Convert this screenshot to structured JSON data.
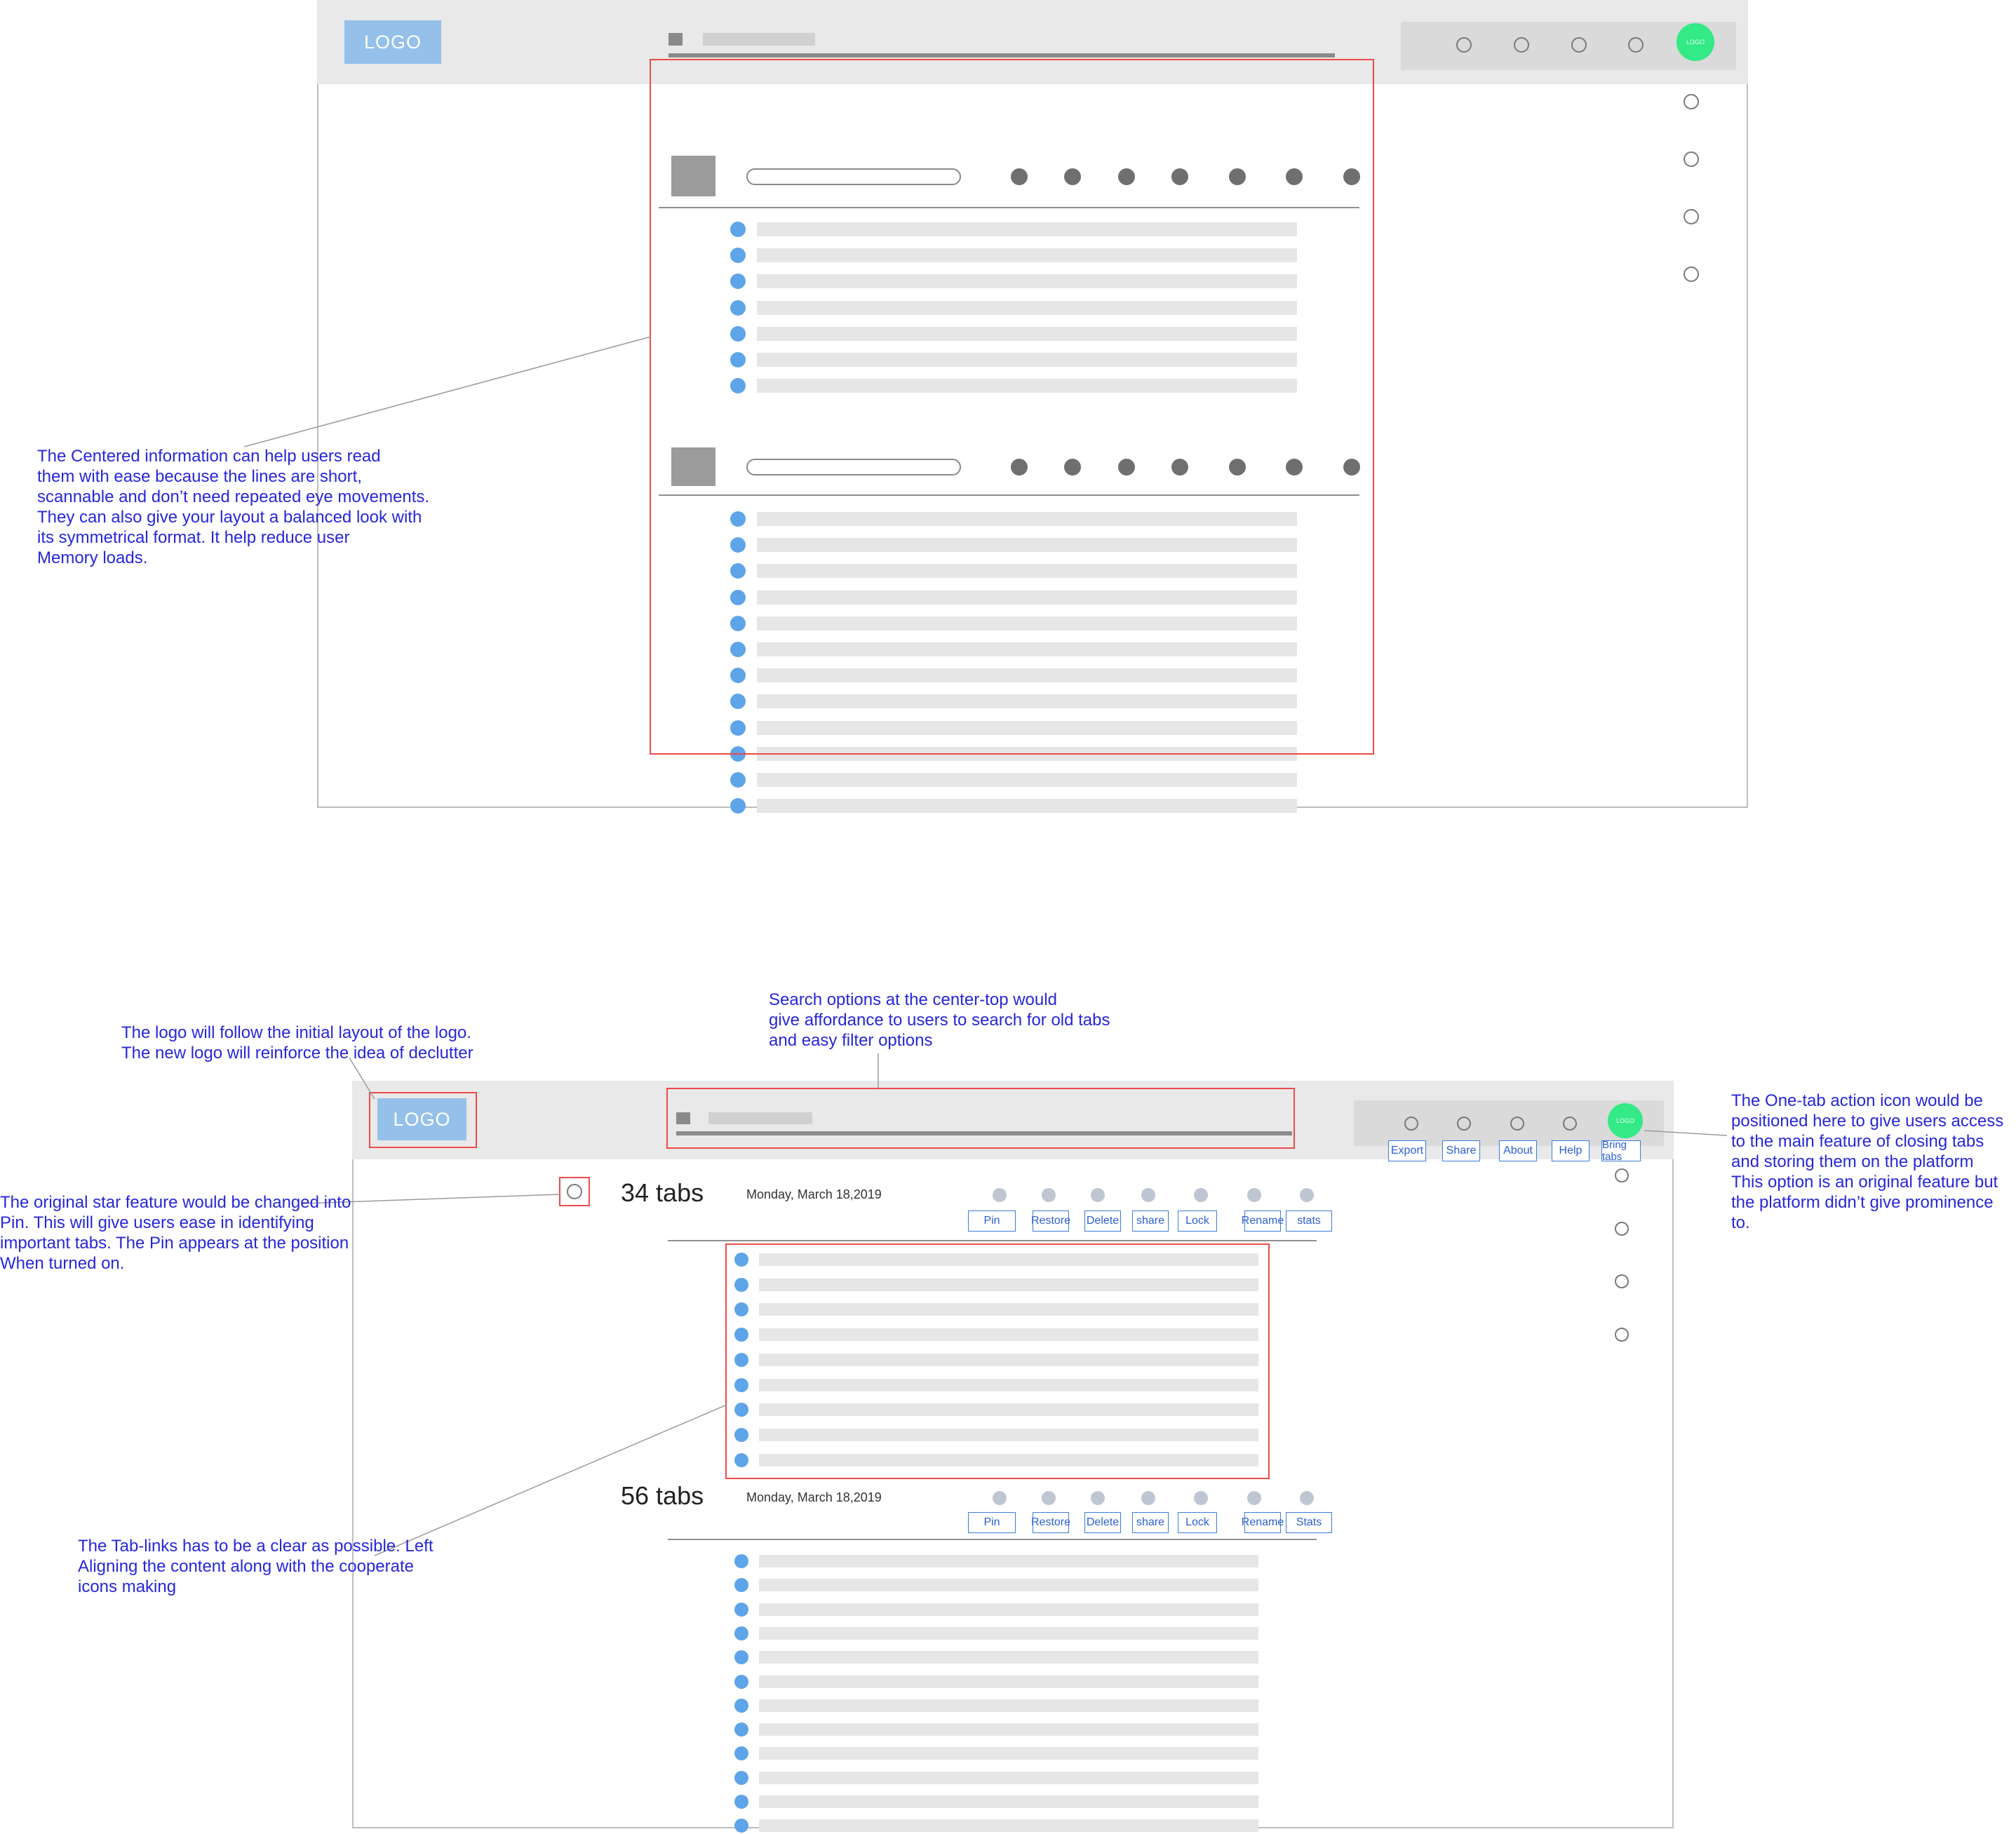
{
  "wireframe_top": {
    "logo_label": "LOGO",
    "avatar_label": "LOGO"
  },
  "wireframe_bottom": {
    "logo_label": "LOGO",
    "avatar_label": "LOGO",
    "toolbar_buttons": [
      "Export",
      "Share",
      "About",
      "Help",
      "Bring tabs"
    ],
    "group1": {
      "count_label": "34 tabs",
      "date": "Monday, March 18,2019",
      "actions": [
        "Pin",
        "Restore",
        "Delete",
        "share",
        "Lock",
        "Rename",
        "stats"
      ]
    },
    "group2": {
      "count_label": "56 tabs",
      "date": "Monday, March 18,2019",
      "actions": [
        "Pin",
        "Restore",
        "Delete",
        "share",
        "Lock",
        "Rename",
        "Stats"
      ]
    }
  },
  "annotations": {
    "centered_info": "The Centered information can help users read\nthem with ease because the lines are short,\nscannable and don’t need repeated eye movements.\nThey can also give your layout a balanced look with\nits symmetrical format. It help reduce user\nMemory loads.",
    "search": "Search options at the center-top would\ngive affordance to users to search for old tabs\nand easy filter options",
    "logo": "The logo will follow the initial layout of the logo.\nThe new logo will reinforce the idea of declutter",
    "one_tab": "The One-tab action icon would be\npositioned here to give users access\n to the main feature of closing tabs\nand storing them on the platform\nThis option is an original feature but\nthe platform didn’t give prominence\nto.",
    "star": "The original star feature would be changed into\nPin. This will give users ease in identifying\nimportant tabs. The Pin appears at the position\nWhen turned on.",
    "tab_links": "The Tab-links has to be a clear as possible. Left\nAligning the content along with the cooperate\n icons making"
  }
}
